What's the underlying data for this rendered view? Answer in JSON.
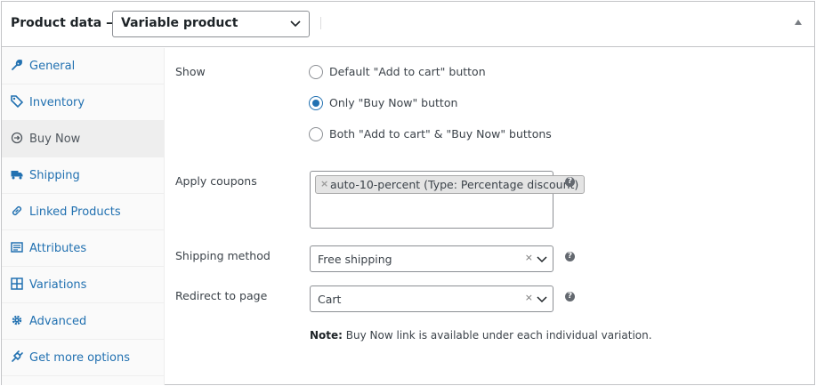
{
  "header": {
    "title": "Product data —",
    "product_type": "Variable product"
  },
  "tabs": [
    {
      "label": "General",
      "icon": "wrench-icon"
    },
    {
      "label": "Inventory",
      "icon": "tag-icon"
    },
    {
      "label": "Buy Now",
      "icon": "arrow-circle-icon",
      "active": true
    },
    {
      "label": "Shipping",
      "icon": "truck-icon"
    },
    {
      "label": "Linked Products",
      "icon": "link-icon"
    },
    {
      "label": "Attributes",
      "icon": "list-icon"
    },
    {
      "label": "Variations",
      "icon": "grid-icon"
    },
    {
      "label": "Advanced",
      "icon": "gear-icon"
    },
    {
      "label": "Get more options",
      "icon": "plugin-icon"
    }
  ],
  "show": {
    "label": "Show",
    "options": [
      {
        "label": "Default \"Add to cart\" button",
        "checked": false
      },
      {
        "label": "Only \"Buy Now\" button",
        "checked": true
      },
      {
        "label": "Both \"Add to cart\" & \"Buy Now\" buttons",
        "checked": false
      }
    ]
  },
  "coupons": {
    "label": "Apply coupons",
    "selected": "auto-10-percent (Type: Percentage discount)",
    "remove_glyph": "×",
    "help": "?"
  },
  "shipping_method": {
    "label": "Shipping method",
    "value": "Free shipping",
    "clear_glyph": "×",
    "help": "?"
  },
  "redirect": {
    "label": "Redirect to page",
    "value": "Cart",
    "clear_glyph": "×",
    "help": "?"
  },
  "note": {
    "bold": "Note:",
    "text": " Buy Now link is available under each individual variation."
  },
  "colors": {
    "link": "#2271b1",
    "border": "#c3c4c7",
    "tab_bg": "#fafafa",
    "tab_active_bg": "#eeeeee"
  }
}
